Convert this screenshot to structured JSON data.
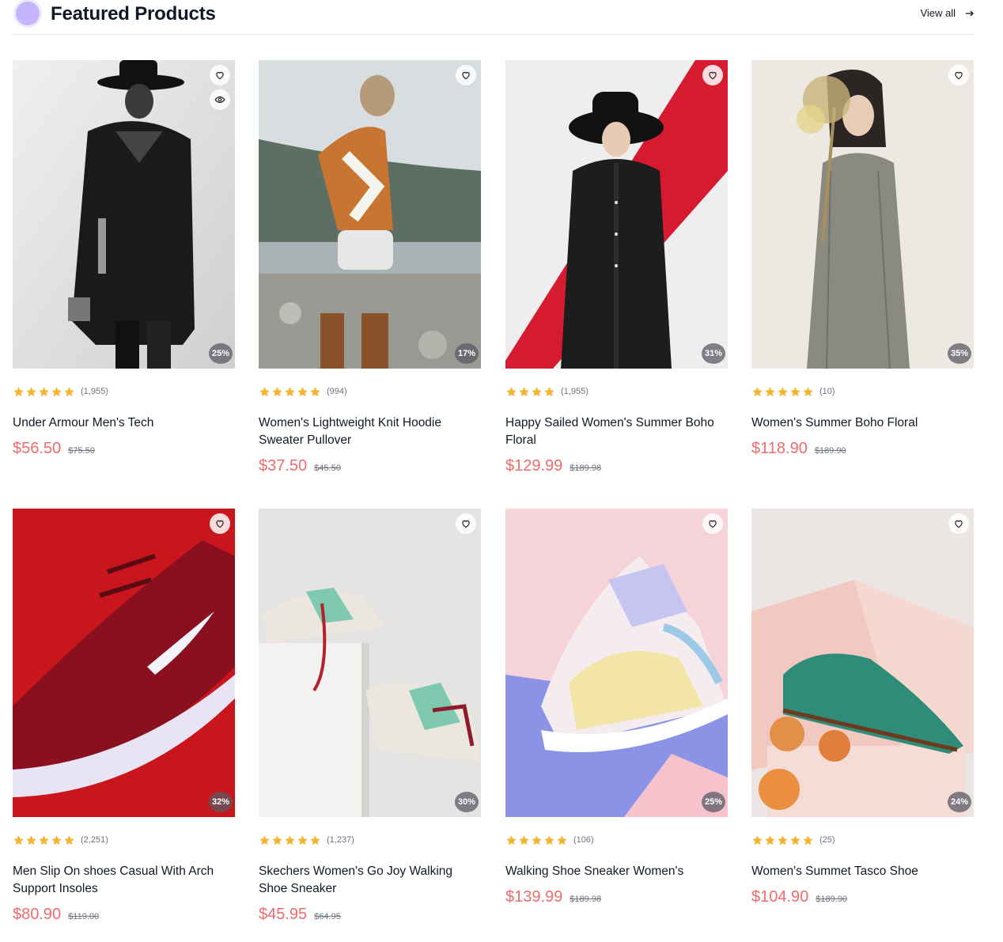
{
  "section": {
    "title": "Featured Products",
    "view_all": "View all"
  },
  "colors": {
    "accent_price": "#ef6b6b",
    "star": "#f5b532",
    "section_dot": "#c4b5fd"
  },
  "products": [
    {
      "name": "Under Armour Men's Tech",
      "rating": 5,
      "reviews": "(1,955)",
      "price": "$56.50",
      "old_price": "$75.50",
      "discount": "25%",
      "image": "man-black-coat-hat"
    },
    {
      "name": "Women's Lightweight Knit Hoodie Sweater Pullover",
      "rating": 5,
      "reviews": "(994)",
      "price": "$37.50",
      "old_price": "$45.50",
      "discount": "17%",
      "image": "woman-sweater-boots"
    },
    {
      "name": "Happy Sailed Women's Summer Boho Floral",
      "rating": 4,
      "reviews": "(1,955)",
      "price": "$129.99",
      "old_price": "$189.98",
      "discount": "31%",
      "image": "woman-black-coat-red"
    },
    {
      "name": "Women's Summer Boho Floral",
      "rating": 5,
      "reviews": "(10)",
      "price": "$118.90",
      "old_price": "$189.90",
      "discount": "35%",
      "image": "woman-grey-dress-flowers"
    },
    {
      "name": "Men Slip On shoes Casual With Arch Support Insoles",
      "rating": 5,
      "reviews": "(2,251)",
      "price": "$80.90",
      "old_price": "$119.00",
      "discount": "32%",
      "image": "red-nike-shoe"
    },
    {
      "name": "Skechers Women's Go Joy Walking Shoe Sneaker",
      "rating": 5,
      "reviews": "(1,237)",
      "price": "$45.95",
      "old_price": "$64.95",
      "discount": "30%",
      "image": "white-sneakers-pedestal"
    },
    {
      "name": "Walking Shoe Sneaker Women's",
      "rating": 5,
      "reviews": "(106)",
      "price": "$139.99",
      "old_price": "$189.98",
      "discount": "25%",
      "image": "pastel-sneaker"
    },
    {
      "name": "Women's Summet Tasco Shoe",
      "rating": 5,
      "reviews": "(25)",
      "price": "$104.90",
      "old_price": "$189.90",
      "discount": "24%",
      "image": "green-suede-shoe"
    }
  ]
}
